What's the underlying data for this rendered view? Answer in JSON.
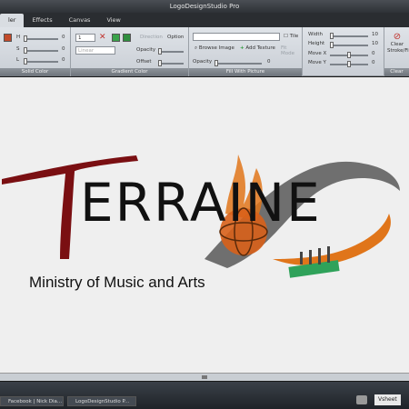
{
  "window": {
    "title": "LogoDesignStudio Pro"
  },
  "tabs": [
    {
      "label": "ler"
    },
    {
      "label": "Effects"
    },
    {
      "label": "Canvas"
    },
    {
      "label": "View"
    }
  ],
  "ribbon": {
    "solid_color": {
      "label": "Solid Color",
      "h_label": "H",
      "h_value": "0",
      "s_label": "S",
      "s_value": "0",
      "l_label": "L",
      "l_value": "0"
    },
    "gradient_color": {
      "label": "Gradient Color",
      "count_value": "1",
      "direction_label": "Direction",
      "option_label": "Option",
      "linear_placeholder": "Linear",
      "opacity_label": "Opacity",
      "offset_label": "Offset"
    },
    "fill_with_picture": {
      "label": "Fill With Picture",
      "tile_label": "Tile",
      "fit_mode_label": "Fit Mode",
      "browse_label": "Browse Image",
      "add_texture_label": "Add Texture",
      "opacity_label": "Opacity",
      "opacity_value": "0"
    },
    "size": {
      "width_label": "Width",
      "width_value": "10",
      "height_label": "Height",
      "height_value": "10",
      "movex_label": "Move X",
      "movex_value": "0",
      "movey_label": "Move Y",
      "movey_value": "0"
    },
    "clear": {
      "label": "Clear Stroke",
      "button_line1": "Clear",
      "button_line2": "Stroke/Fill"
    }
  },
  "logo": {
    "title": "ERRAINE",
    "subtitle": "Ministry of Music and Arts"
  },
  "taskbar": {
    "items": [
      {
        "label": "Facebook | Nick Dia..."
      },
      {
        "label": "LogoDesignStudio P..."
      }
    ],
    "tray_text": "Vsheet"
  },
  "colors": {
    "accent_red": "#7a0f12",
    "swoosh_gray": "#6f6f6f",
    "flame": "#e0751a",
    "green_bars": "#2fa25a"
  }
}
